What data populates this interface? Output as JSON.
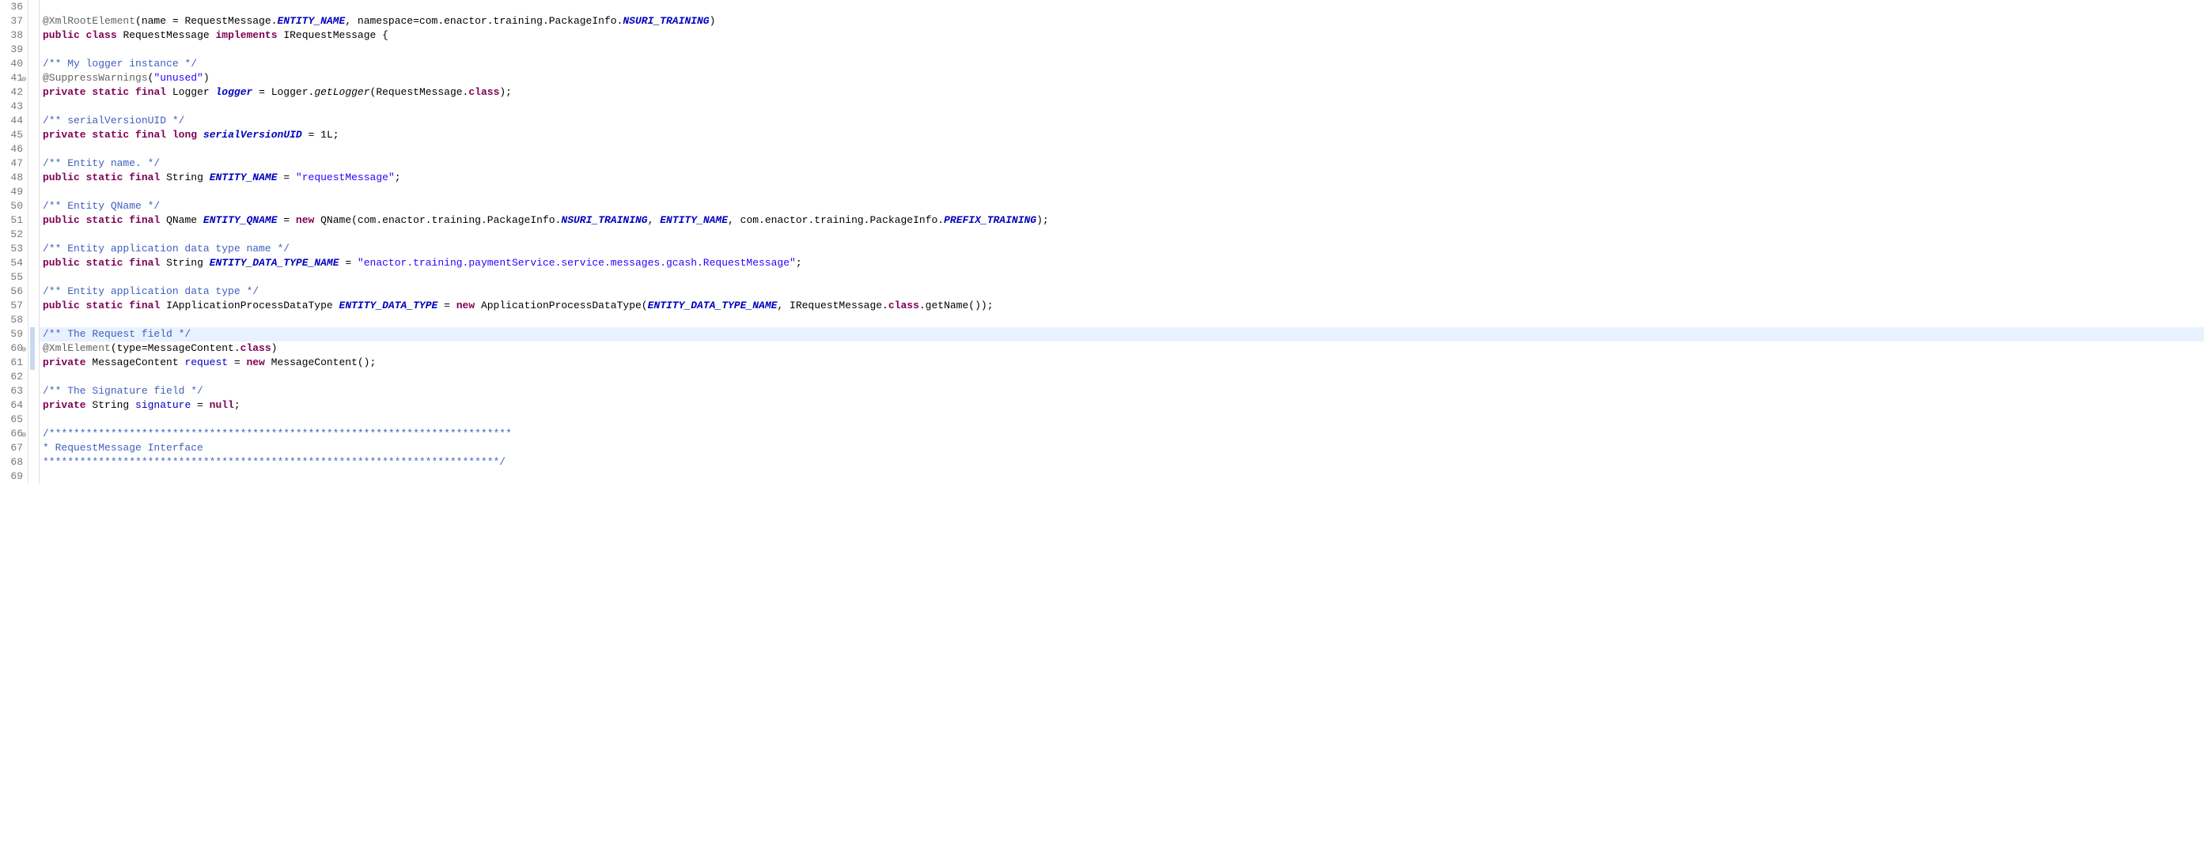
{
  "gutter": {
    "start": 36,
    "end": 69,
    "fold_markers": [
      41,
      60,
      66
    ],
    "change_markers_at": [
      59,
      60,
      61
    ]
  },
  "code": {
    "l36": "",
    "l37": {
      "ann": "@XmlRootElement",
      "p1": "(name = RequestMessage.",
      "f1": "ENTITY_NAME",
      "p2": ", namespace=com.enactor.training.PackageInfo.",
      "f2": "NSURI_TRAINING",
      "p3": ")"
    },
    "l38": {
      "k1": "public",
      "k2": "class",
      "t1": "RequestMessage",
      "k3": "implements",
      "t2": "IRequestMessage",
      "p1": " {"
    },
    "l39": "",
    "l40": {
      "c": "/** My logger instance */"
    },
    "l41": {
      "ann": "@SuppressWarnings",
      "p1": "(",
      "s1": "\"unused\"",
      "p2": ")"
    },
    "l42": {
      "k1": "private",
      "k2": "static",
      "k3": "final",
      "t1": "Logger ",
      "f1": "logger",
      "p1": " = Logger.",
      "m1": "getLogger",
      "p2": "(RequestMessage.",
      "k4": "class",
      "p3": ");"
    },
    "l43": "",
    "l44": {
      "c": "/** serialVersionUID */"
    },
    "l45": {
      "k1": "private",
      "k2": "static",
      "k3": "final",
      "k4": "long",
      "f1": "serialVersionUID",
      "p1": " = 1L;"
    },
    "l46": "",
    "l47": {
      "c": "/** Entity name. */"
    },
    "l48": {
      "k1": "public",
      "k2": "static",
      "k3": "final",
      "t1": "String ",
      "f1": "ENTITY_NAME",
      "p1": " = ",
      "s1": "\"requestMessage\"",
      "p2": ";"
    },
    "l49": "",
    "l50": {
      "c": "/** Entity QName */"
    },
    "l51": {
      "k1": "public",
      "k2": "static",
      "k3": "final",
      "t1": "QName ",
      "f1": "ENTITY_QNAME",
      "p1": " = ",
      "k4": "new",
      "p2": " QName(com.enactor.training.PackageInfo.",
      "f2": "NSURI_TRAINING",
      "p3": ", ",
      "f3": "ENTITY_NAME",
      "p4": ", com.enactor.training.PackageInfo.",
      "f4": "PREFIX_TRAINING",
      "p5": ");"
    },
    "l52": "",
    "l53": {
      "c": "/** Entity application data type name */"
    },
    "l54": {
      "k1": "public",
      "k2": "static",
      "k3": "final",
      "t1": "String ",
      "f1": "ENTITY_DATA_TYPE_NAME",
      "p1": " = ",
      "s1": "\"enactor.training.paymentService.service.messages.gcash.RequestMessage\"",
      "p2": ";"
    },
    "l55": "",
    "l56": {
      "c": "/** Entity application data type */"
    },
    "l57": {
      "k1": "public",
      "k2": "static",
      "k3": "final",
      "t1": "IApplicationProcessDataType ",
      "f1": "ENTITY_DATA_TYPE",
      "p1": " = ",
      "k4": "new",
      "p2": " ApplicationProcessDataType(",
      "f2": "ENTITY_DATA_TYPE_NAME",
      "p3": ", IRequestMessage.",
      "k5": "class",
      "p4": ".getName());"
    },
    "l58": "",
    "l59": {
      "c": "/** The Request field */"
    },
    "l60": {
      "ann": "@XmlElement",
      "p1": "(type=MessageContent.",
      "k1": "class",
      "p2": ")"
    },
    "l61": {
      "k1": "private",
      "t1": " MessageContent ",
      "f1": "request",
      "p1": " = ",
      "k2": "new",
      "p2": " MessageContent();"
    },
    "l62": "",
    "l63": {
      "c": "/** The Signature field */"
    },
    "l64": {
      "k1": "private",
      "t1": " String ",
      "f1": "signature",
      "p1": " = ",
      "k2": "null",
      "p2": ";"
    },
    "l65": "",
    "l66": {
      "c": "/***************************************************************************"
    },
    "l67": {
      "c": " * RequestMessage Interface"
    },
    "l68": {
      "c": " **************************************************************************/"
    },
    "l69": ""
  },
  "indent": "    ",
  "highlight_lines": [
    59
  ]
}
